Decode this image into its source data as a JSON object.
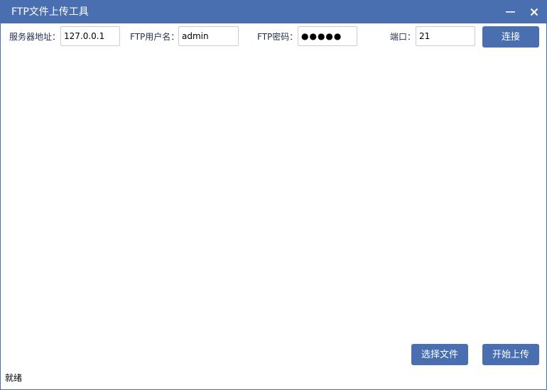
{
  "window": {
    "title": "FTP文件上传工具",
    "controls": {
      "minimize_icon": "minimize-icon",
      "close_icon": "close-icon"
    }
  },
  "connection": {
    "server_label": "服务器地址：",
    "server_value": "127.0.0.1",
    "user_label": "FTP用户名：",
    "user_value": "admin",
    "password_label": "FTP密码：",
    "password_value": "●●●●●",
    "port_label": "端口：",
    "port_value": "21",
    "connect_button": "连接"
  },
  "actions": {
    "choose_file_button": "选择文件",
    "start_upload_button": "开始上传"
  },
  "status": {
    "text": "就绪"
  },
  "colors": {
    "accent": "#4a6fb0",
    "background": "#ffffff",
    "input_border": "#c9cdd3"
  }
}
